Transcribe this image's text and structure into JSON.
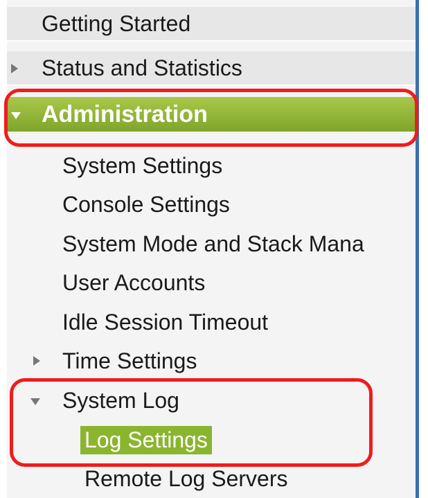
{
  "nav": {
    "getting_started": "Getting Started",
    "status_and_statistics": "Status and Statistics",
    "administration": "Administration",
    "admin_children": {
      "system_settings": "System Settings",
      "console_settings": "Console Settings",
      "system_mode": "System Mode and Stack Mana",
      "user_accounts": "User Accounts",
      "idle_session_timeout": "Idle Session Timeout",
      "time_settings": "Time Settings",
      "system_log": "System Log"
    },
    "system_log_children": {
      "log_settings": "Log Settings",
      "remote_log_servers": "Remote Log Servers"
    }
  },
  "colors": {
    "active_green": "#8ab52e",
    "callout_red": "#f01c1c",
    "nav_border_blue": "#3a6fb0"
  }
}
